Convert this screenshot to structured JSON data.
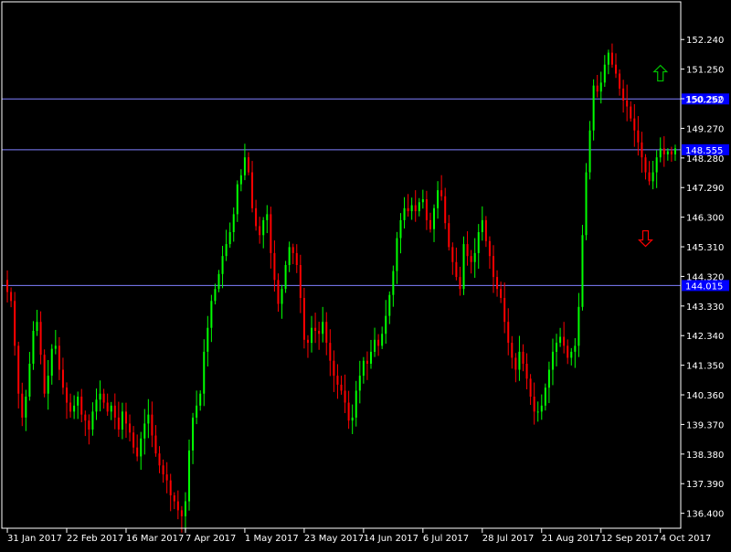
{
  "chart_data": {
    "type": "candlestick",
    "title": "",
    "xlabel": "",
    "ylabel": "",
    "ylim": [
      135.9,
      153.5
    ],
    "colors": {
      "background": "#000000",
      "frame": "#ffffff",
      "text": "#ffffff",
      "bull": "#00ff00",
      "bear": "#ff0000",
      "level_line": "#8080ff",
      "level_tag": "#0000ff",
      "arrow_up": "#00c000",
      "arrow_down": "#ff0000"
    },
    "y_ticks": [
      "152.240",
      "151.250",
      "150.260",
      "149.270",
      "148.280",
      "147.290",
      "146.300",
      "145.310",
      "144.320",
      "143.330",
      "142.340",
      "141.350",
      "140.360",
      "139.370",
      "138.380",
      "137.390",
      "136.400"
    ],
    "x_ticks": [
      {
        "index": 0,
        "label": "31 Jan 2017"
      },
      {
        "index": 16,
        "label": "22 Feb 2017"
      },
      {
        "index": 32,
        "label": "16 Mar 2017"
      },
      {
        "index": 48,
        "label": "7 Apr 2017"
      },
      {
        "index": 64,
        "label": "1 May 2017"
      },
      {
        "index": 80,
        "label": "23 May 2017"
      },
      {
        "index": 96,
        "label": "14 Jun 2017"
      },
      {
        "index": 112,
        "label": "6 Jul 2017"
      },
      {
        "index": 128,
        "label": "28 Jul 2017"
      },
      {
        "index": 144,
        "label": "21 Aug 2017"
      },
      {
        "index": 160,
        "label": "12 Sep 2017"
      },
      {
        "index": 176,
        "label": "4 Oct 2017"
      }
    ],
    "levels": [
      {
        "value": 150.252,
        "label": "150.252"
      },
      {
        "value": 148.555,
        "label": "148.555"
      },
      {
        "value": 144.015,
        "label": "144.015"
      }
    ],
    "arrows": [
      {
        "direction": "up",
        "index": 176,
        "value": 151.1
      },
      {
        "direction": "down",
        "index": 172,
        "value": 145.6
      }
    ],
    "closes": [
      143.8,
      143.5,
      142.0,
      140.4,
      139.6,
      140.3,
      141.4,
      142.5,
      142.8,
      141.7,
      140.4,
      141.0,
      141.9,
      142.0,
      141.2,
      140.6,
      140.1,
      139.8,
      140.0,
      140.3,
      139.7,
      139.5,
      139.2,
      139.8,
      140.2,
      140.4,
      140.1,
      139.8,
      140.0,
      139.6,
      139.2,
      139.8,
      139.4,
      139.1,
      138.6,
      138.3,
      138.9,
      139.4,
      139.7,
      139.0,
      138.4,
      138.0,
      137.7,
      137.5,
      137.0,
      136.8,
      136.5,
      136.3,
      136.8,
      138.5,
      139.6,
      140.0,
      140.4,
      141.8,
      142.6,
      143.5,
      143.9,
      144.4,
      145.0,
      145.4,
      145.8,
      146.4,
      147.4,
      147.7,
      148.3,
      147.8,
      146.6,
      146.0,
      145.7,
      146.2,
      146.4,
      145.1,
      144.2,
      143.4,
      143.9,
      144.7,
      145.3,
      145.1,
      144.7,
      143.6,
      142.2,
      142.1,
      142.6,
      142.5,
      142.4,
      142.8,
      142.1,
      141.5,
      141.0,
      140.7,
      140.5,
      140.1,
      139.5,
      139.6,
      140.5,
      141.0,
      141.5,
      141.4,
      141.8,
      142.2,
      142.0,
      142.4,
      143.0,
      143.7,
      144.5,
      145.6,
      146.2,
      146.6,
      146.5,
      146.7,
      146.5,
      146.8,
      146.9,
      146.2,
      145.9,
      146.6,
      147.2,
      147.0,
      146.1,
      145.3,
      144.8,
      144.3,
      143.9,
      145.4,
      145.0,
      144.8,
      145.1,
      145.8,
      146.2,
      145.5,
      145.0,
      144.3,
      143.9,
      143.6,
      142.8,
      142.1,
      141.6,
      141.2,
      141.8,
      141.4,
      140.9,
      140.3,
      139.8,
      139.8,
      140.0,
      140.6,
      141.2,
      141.8,
      142.1,
      142.3,
      142.0,
      141.6,
      141.8,
      142.0,
      143.3,
      145.7,
      147.8,
      149.2,
      150.7,
      150.5,
      150.8,
      151.4,
      151.8,
      151.4,
      151.1,
      150.6,
      150.2,
      150.0,
      149.6,
      149.2,
      148.8,
      148.3,
      147.8,
      147.5,
      147.8,
      148.3,
      148.6,
      148.4,
      148.5,
      148.4,
      148.6
    ]
  }
}
